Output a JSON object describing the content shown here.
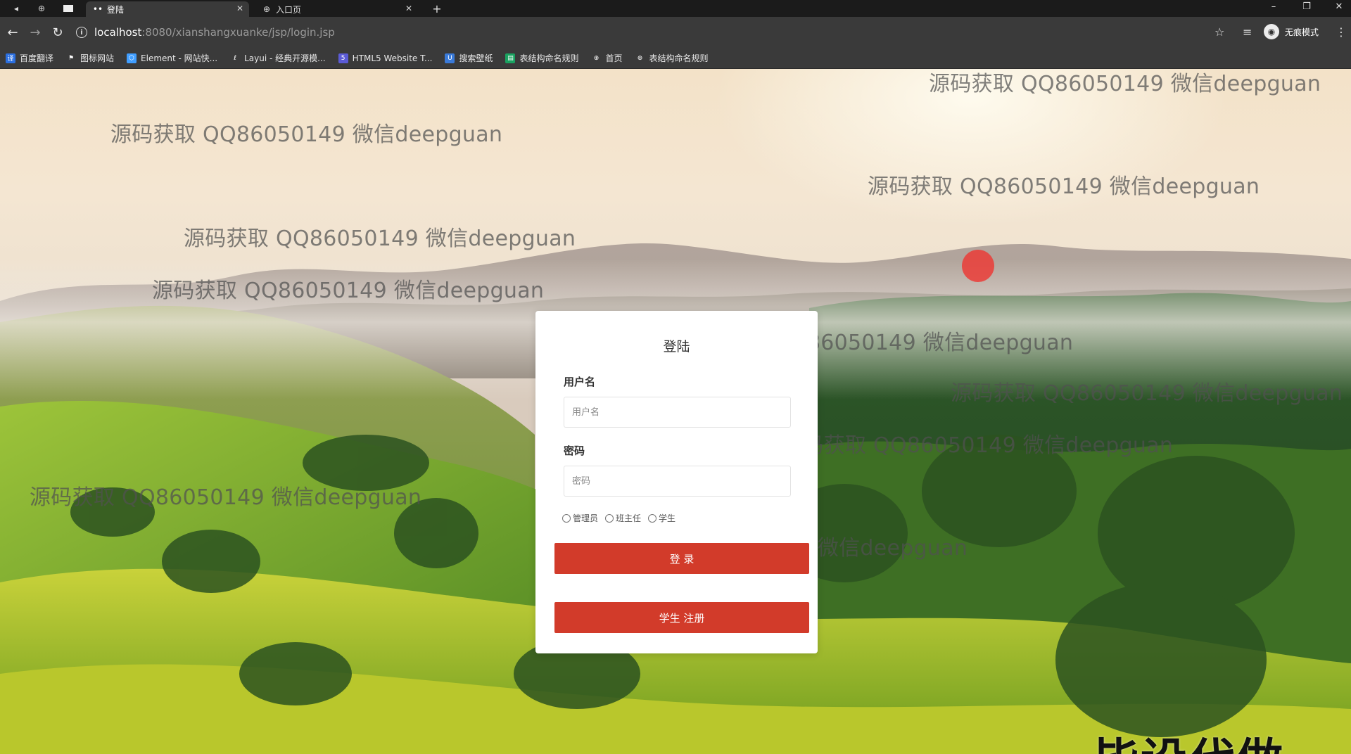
{
  "tabs": [
    {
      "title": "登陆",
      "active": true
    },
    {
      "title": "入口页",
      "active": false
    }
  ],
  "address": {
    "host": "localhost",
    "path": ":8080/xianshangxuanke/jsp/login.jsp"
  },
  "incognito_label": "无痕模式",
  "bookmarks": [
    {
      "label": "百度翻译",
      "icon": "translate-icon",
      "color": "#2b6fe0"
    },
    {
      "label": "图标网站",
      "icon": "flag-icon",
      "color": "#3a3a3a"
    },
    {
      "label": "Element - 网站快...",
      "icon": "element-icon",
      "color": "#409eff"
    },
    {
      "label": "Layui - 经典开源模...",
      "icon": "layui-icon",
      "color": "#3a3a3a"
    },
    {
      "label": "HTML5 Website T...",
      "icon": "html5-icon",
      "color": "#5b5bd6"
    },
    {
      "label": "搜索壁纸",
      "icon": "wallpaper-icon",
      "color": "#3a7ad8"
    },
    {
      "label": "表结构命名规则",
      "icon": "table-icon",
      "color": "#1aa260"
    },
    {
      "label": "首页",
      "icon": "globe-icon",
      "color": "#3a3a3a"
    },
    {
      "label": "表结构命名规则",
      "icon": "globe-icon",
      "color": "#3a3a3a"
    }
  ],
  "login": {
    "title": "登陆",
    "username_label": "用户名",
    "username_placeholder": "用户名",
    "password_label": "密码",
    "password_placeholder": "密码",
    "roles": [
      "管理员",
      "班主任",
      "学生"
    ],
    "login_button": "登 录",
    "register_button": "学生 注册"
  },
  "watermark_text": "源码获取 QQ86050149 微信deepguan",
  "overlay_text": "毕设代做",
  "colors": {
    "primary_button": "#d23b2a",
    "chrome_dark": "#1b1b1b",
    "chrome": "#3a3a3a"
  }
}
